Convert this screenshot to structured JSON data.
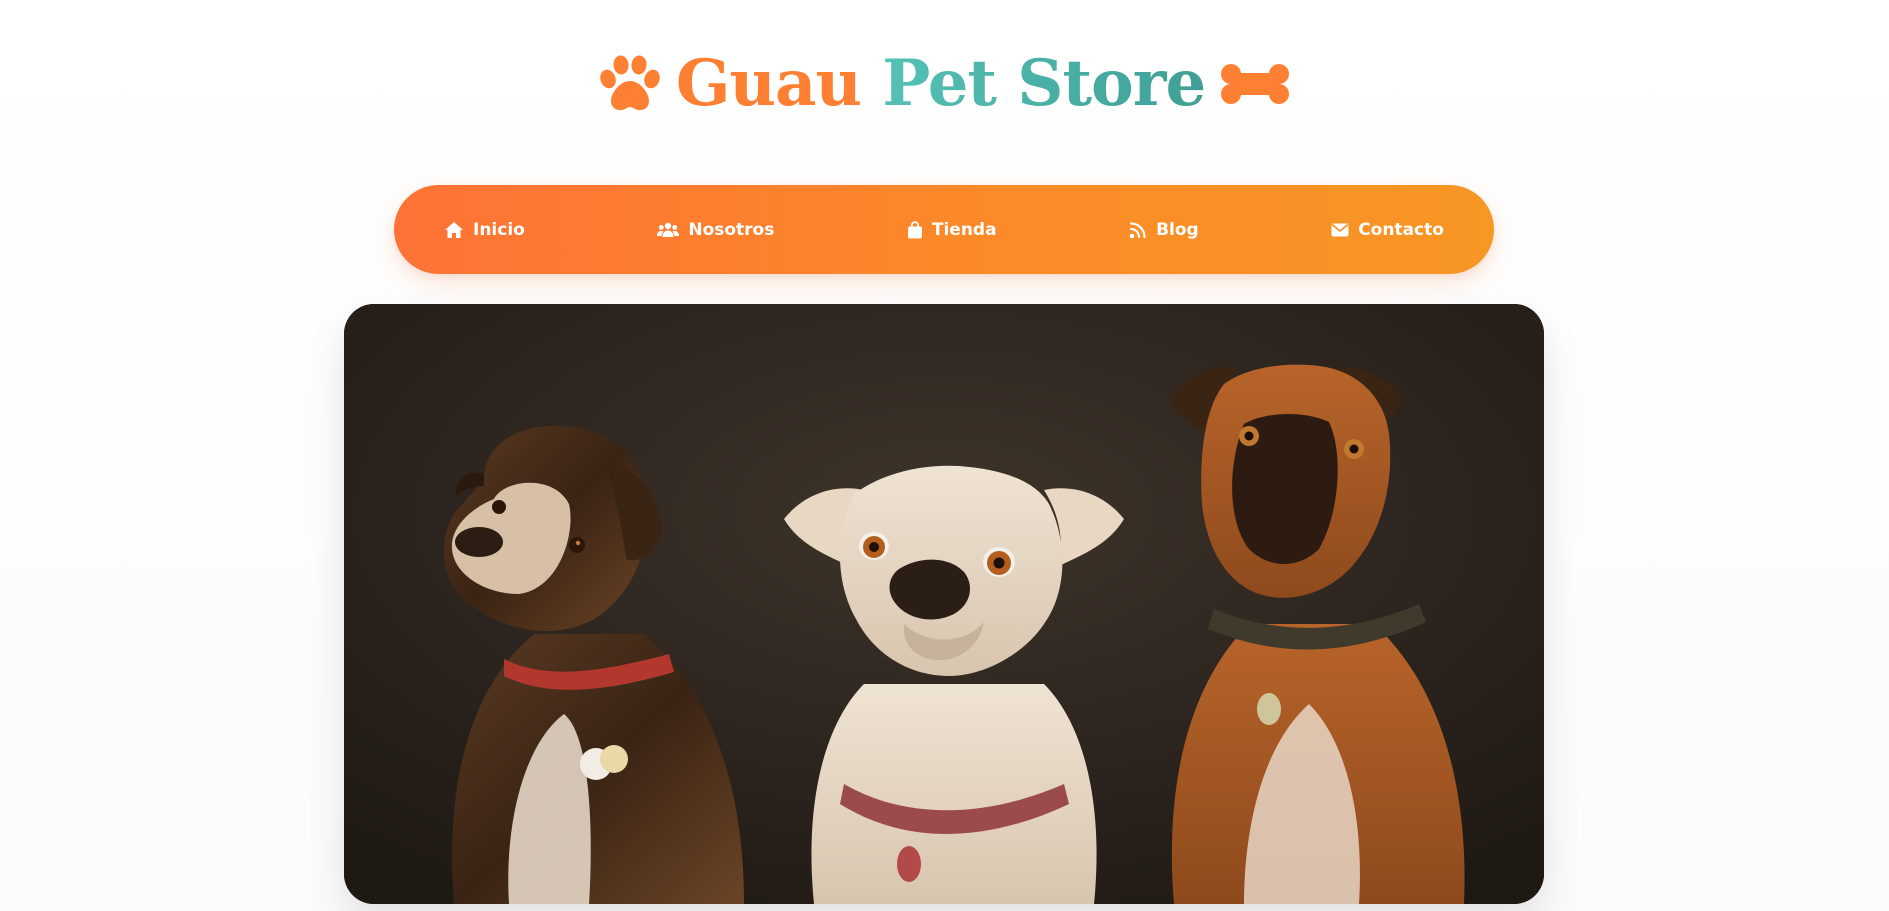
{
  "brand": {
    "word_1": "Guau",
    "word_2": "Pet Store",
    "left_icon": "paw-icon",
    "right_icon": "bone-icon",
    "colors": {
      "orange": "#ff7f33",
      "teal": "#4fb3a9"
    }
  },
  "nav": {
    "items": [
      {
        "label": "Inicio",
        "icon": "home-icon"
      },
      {
        "label": "Nosotros",
        "icon": "users-icon"
      },
      {
        "label": "Tienda",
        "icon": "shopping-bag-icon"
      },
      {
        "label": "Blog",
        "icon": "rss-icon"
      },
      {
        "label": "Contacto",
        "icon": "envelope-icon"
      }
    ],
    "gradient_start": "#ff7236",
    "gradient_end": "#f79724"
  },
  "hero": {
    "image": "three-dogs-photo"
  }
}
